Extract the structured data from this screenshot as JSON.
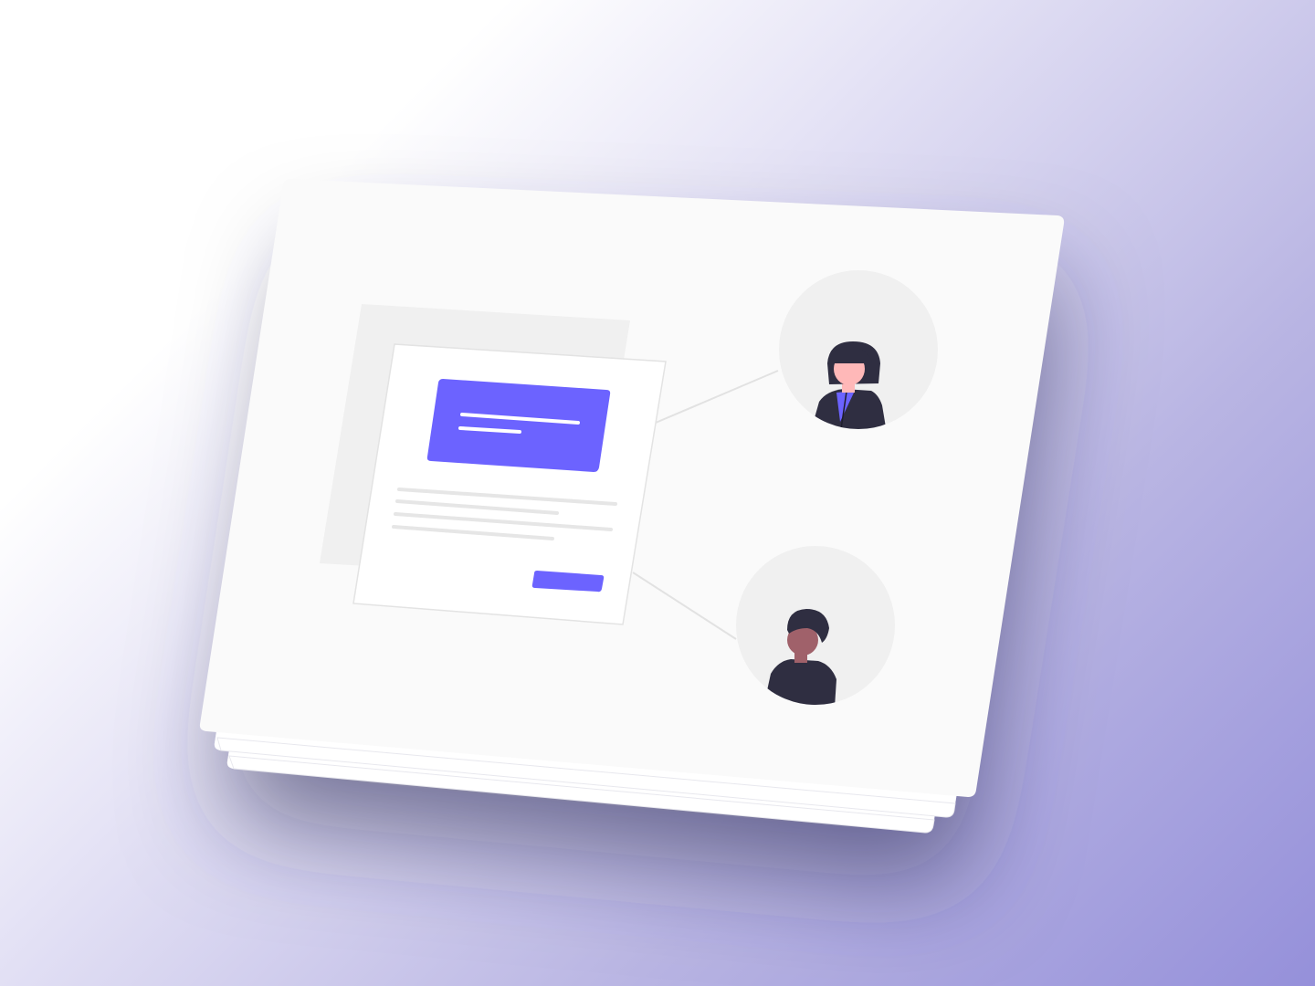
{
  "illustration": {
    "subject": "document-shared-with-two-people",
    "icons": [
      "document-icon",
      "user-woman-avatar-icon",
      "user-man-avatar-icon"
    ]
  },
  "colors": {
    "accent": "#6c63ff",
    "card": "#fafafa",
    "placeholder": "#f0f0f0",
    "text_line": "#e6e6e6",
    "hair_clothing": "#2f2e41",
    "skin_light": "#ffb8b8",
    "skin_dark": "#a0616a"
  }
}
